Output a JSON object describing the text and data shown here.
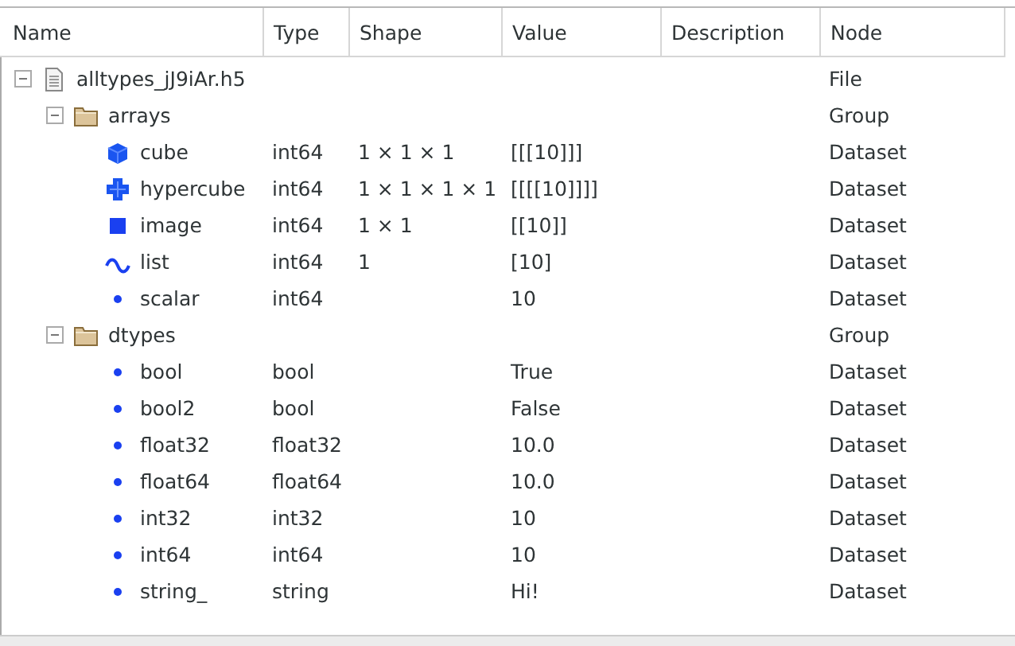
{
  "table": {
    "columns": [
      "Name",
      "Type",
      "Shape",
      "Value",
      "Description",
      "Node"
    ],
    "rows": [
      {
        "kind": "file",
        "name": "alltypes_jJ9iAr.h5",
        "node": "File",
        "expanded": true,
        "children": [
          {
            "kind": "group",
            "name": "arrays",
            "node": "Group",
            "expanded": true,
            "children": [
              {
                "kind": "cube",
                "name": "cube",
                "type": "int64",
                "shape": "1 × 1 × 1",
                "value": "[[[10]]]",
                "node": "Dataset"
              },
              {
                "kind": "hypercube",
                "name": "hypercube",
                "type": "int64",
                "shape": "1 × 1 × 1 × 1",
                "value": "[[[[10]]]]",
                "node": "Dataset"
              },
              {
                "kind": "image",
                "name": "image",
                "type": "int64",
                "shape": "1 × 1",
                "value": "[[10]]",
                "node": "Dataset"
              },
              {
                "kind": "list",
                "name": "list",
                "type": "int64",
                "shape": "1",
                "value": "[10]",
                "node": "Dataset"
              },
              {
                "kind": "scalar",
                "name": "scalar",
                "type": "int64",
                "value": "10",
                "node": "Dataset"
              }
            ]
          },
          {
            "kind": "group",
            "name": "dtypes",
            "node": "Group",
            "expanded": true,
            "children": [
              {
                "kind": "scalar",
                "name": "bool",
                "type": "bool",
                "value": "True",
                "node": "Dataset"
              },
              {
                "kind": "scalar",
                "name": "bool2",
                "type": "bool",
                "value": "False",
                "node": "Dataset"
              },
              {
                "kind": "scalar",
                "name": "float32",
                "type": "float32",
                "value": "10.0",
                "node": "Dataset"
              },
              {
                "kind": "scalar",
                "name": "float64",
                "type": "float64",
                "value": "10.0",
                "node": "Dataset"
              },
              {
                "kind": "scalar",
                "name": "int32",
                "type": "int32",
                "value": "10",
                "node": "Dataset"
              },
              {
                "kind": "scalar",
                "name": "int64",
                "type": "int64",
                "value": "10",
                "node": "Dataset"
              },
              {
                "kind": "scalar",
                "name": "string_",
                "type": "string",
                "value": "Hi!",
                "node": "Dataset"
              }
            ]
          }
        ]
      }
    ]
  }
}
